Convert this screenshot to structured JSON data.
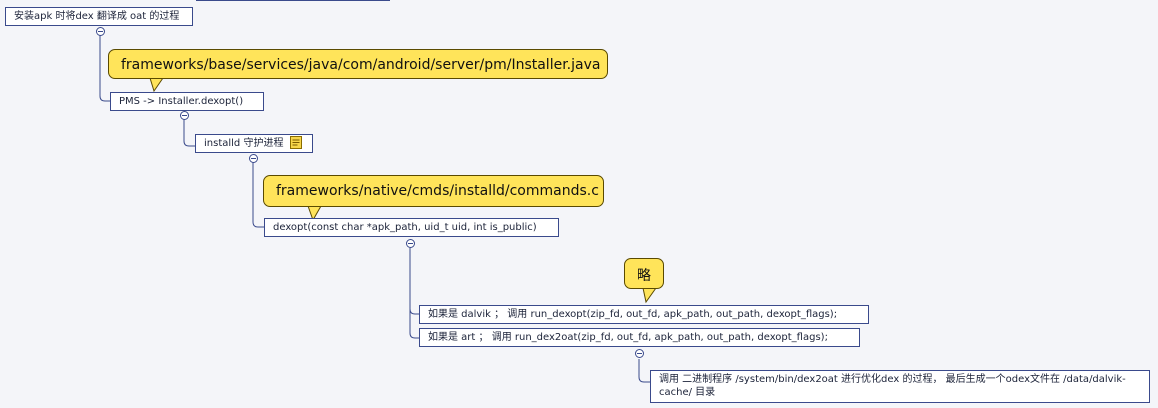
{
  "nodes": {
    "root": "安装apk 时将dex 翻译成 oat 的过程",
    "pms": "PMS -> Installer.dexopt()",
    "installd": "installd 守护进程",
    "dexopt": "dexopt(const char *apk_path, uid_t uid, int is_public)",
    "dalvik": "如果是 dalvik ； 调用 run_dexopt(zip_fd, out_fd, apk_path, out_path, dexopt_flags);",
    "art": "如果是 art ； 调用 run_dex2oat(zip_fd, out_fd, apk_path, out_path, dexopt_flags);",
    "dex2oat_line1": "调用 二进制程序 /system/bin/dex2oat 进行优化dex 的过程， 最后生成一个odex文件在 /data/dalvik-",
    "dex2oat_line2": "cache/ 目录"
  },
  "callouts": {
    "installer_path": "frameworks/base/services/java/com/android/server/pm/Installer.java",
    "commands_path": "frameworks/native/cmds/installd/commands.c",
    "omitted": "略"
  },
  "icons": {
    "collapse": "collapse-minus-icon",
    "note": "note-icon"
  },
  "colors": {
    "line": "#3a4a8c",
    "callout": "#ffe45a",
    "background": "#f4f5f9"
  }
}
